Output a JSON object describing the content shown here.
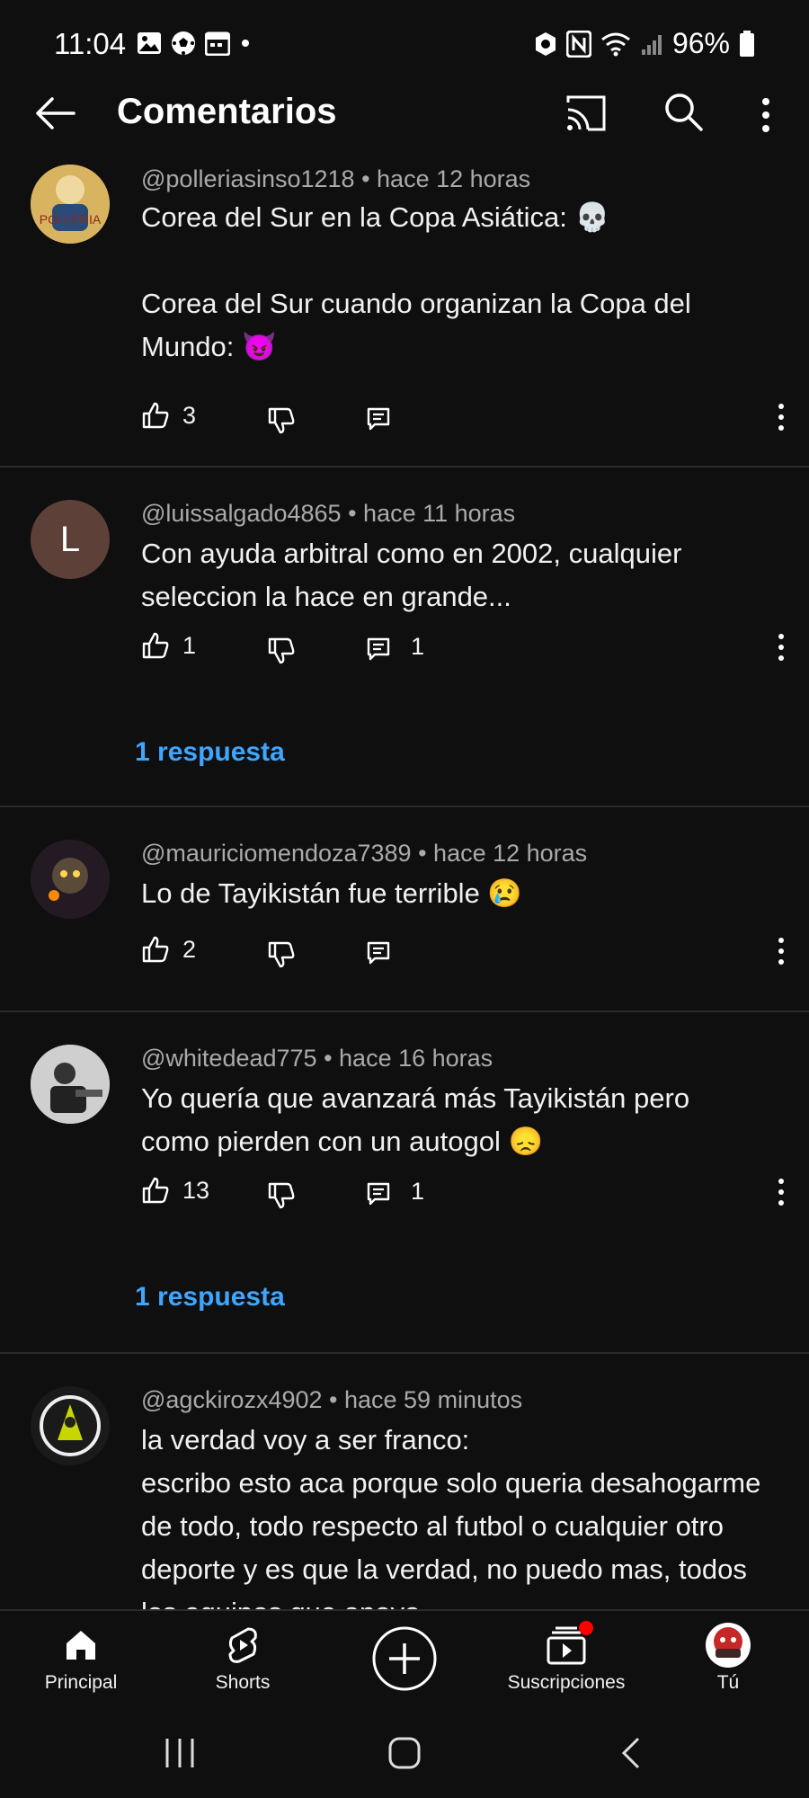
{
  "status_bar": {
    "time": "11:04",
    "battery": "96%"
  },
  "header": {
    "title": "Comentarios"
  },
  "comments": [
    {
      "author": "@polleriasinso1218",
      "time": "hace 12 horas",
      "text": "Corea del Sur en la Copa Asiática: 💀\n\nCorea del Sur cuando organizan la Copa del Mundo: 😈",
      "likes": "3",
      "replies": "",
      "avatar_text": "POLLERIA"
    },
    {
      "author": "@luissalgado4865",
      "time": "hace 11 horas",
      "text": "Con ayuda arbitral como en 2002, cualquier seleccion la hace en grande...",
      "likes": "1",
      "replies": "1",
      "avatar_text": "L",
      "replies_link": "1 respuesta"
    },
    {
      "author": "@mauriciomendoza7389",
      "time": "hace 12 horas",
      "text": "Lo de Tayikistán fue terrible 😢",
      "likes": "2",
      "replies": ""
    },
    {
      "author": "@whitedead775",
      "time": "hace 16 horas",
      "text": "Yo quería que avanzará más Tayikistán pero como pierden con un autogol 😞",
      "likes": "13",
      "replies": "1",
      "replies_link": "1 respuesta"
    },
    {
      "author": "@agckirozx4902",
      "time": "hace 59 minutos",
      "text": "la verdad voy a ser franco:\nescribo esto aca porque solo queria desahogarme de todo, todo respecto al futbol o cualquier otro deporte y es que la verdad, no puedo mas, todos los equipos que apoyo"
    }
  ],
  "bottom_nav": [
    {
      "label": "Principal",
      "icon": "home-icon"
    },
    {
      "label": "Shorts",
      "icon": "shorts-icon"
    },
    {
      "label": "",
      "icon": "create-icon"
    },
    {
      "label": "Suscripciones",
      "icon": "subscriptions-icon"
    },
    {
      "label": "Tú",
      "icon": "profile-icon"
    }
  ],
  "colors": {
    "background": "#0f0f0f",
    "link": "#3ea6ff",
    "meta": "#aaaaaa",
    "divider": "#2b2b2b",
    "badge": "#ff0000"
  }
}
